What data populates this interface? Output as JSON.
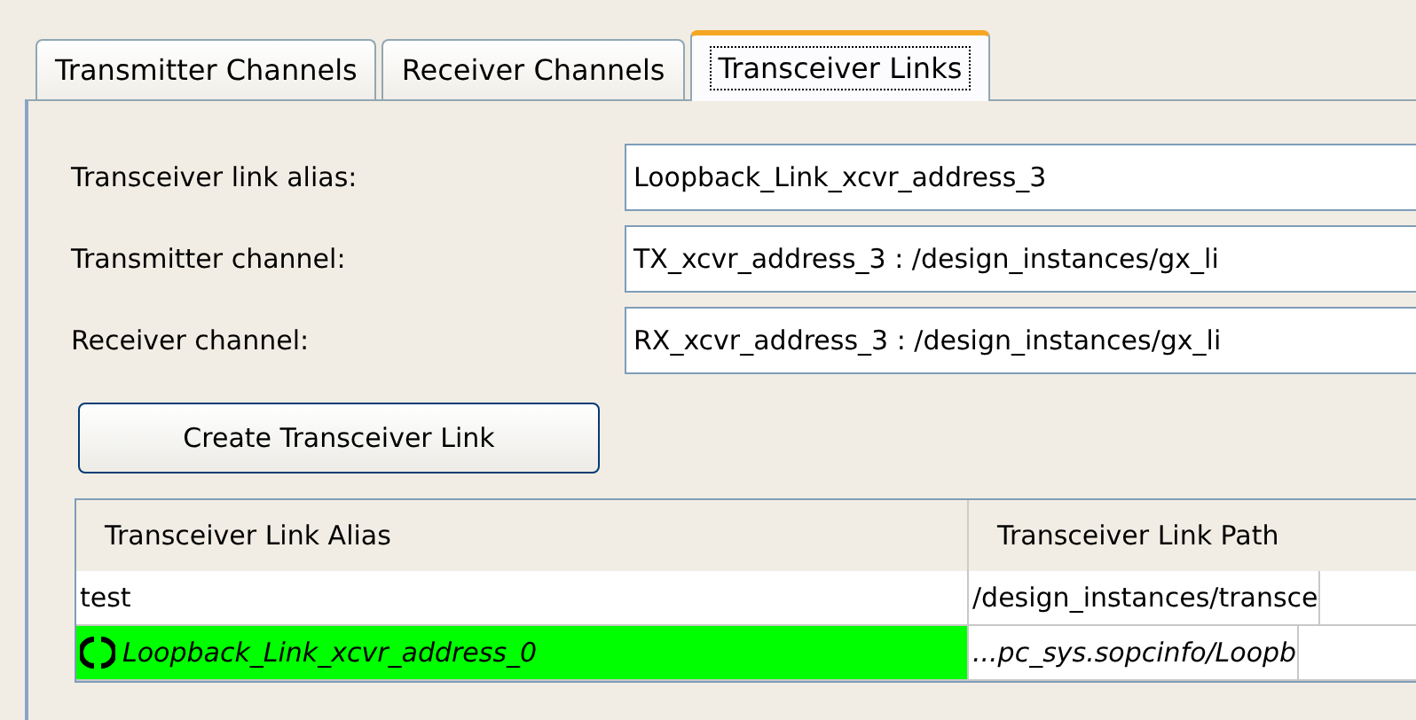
{
  "tabs": [
    {
      "label": "Transmitter Channels",
      "selected": false
    },
    {
      "label": "Receiver Channels",
      "selected": false
    },
    {
      "label": "Transceiver Links",
      "selected": true
    }
  ],
  "form": {
    "fields": [
      {
        "label": "Transceiver link alias:",
        "value": "Loopback_Link_xcvr_address_3"
      },
      {
        "label": "Transmitter channel:",
        "value": "TX_xcvr_address_3 : /design_instances/gx_li"
      },
      {
        "label": "Receiver channel:",
        "value": "RX_xcvr_address_3 : /design_instances/gx_li"
      }
    ],
    "button": "Create Transceiver Link"
  },
  "table": {
    "columns": [
      "Transceiver Link Alias",
      "Transceiver Link Path"
    ],
    "rows": [
      {
        "kind": "plain",
        "color": "#ffffff",
        "cells": [
          "test",
          "/design_instances/transce"
        ]
      },
      {
        "kind": "running",
        "color": "#00ff00",
        "cells": [
          "Loopback_Link_xcvr_address_0",
          "...pc_sys.sopcinfo/Loopb"
        ]
      }
    ]
  }
}
